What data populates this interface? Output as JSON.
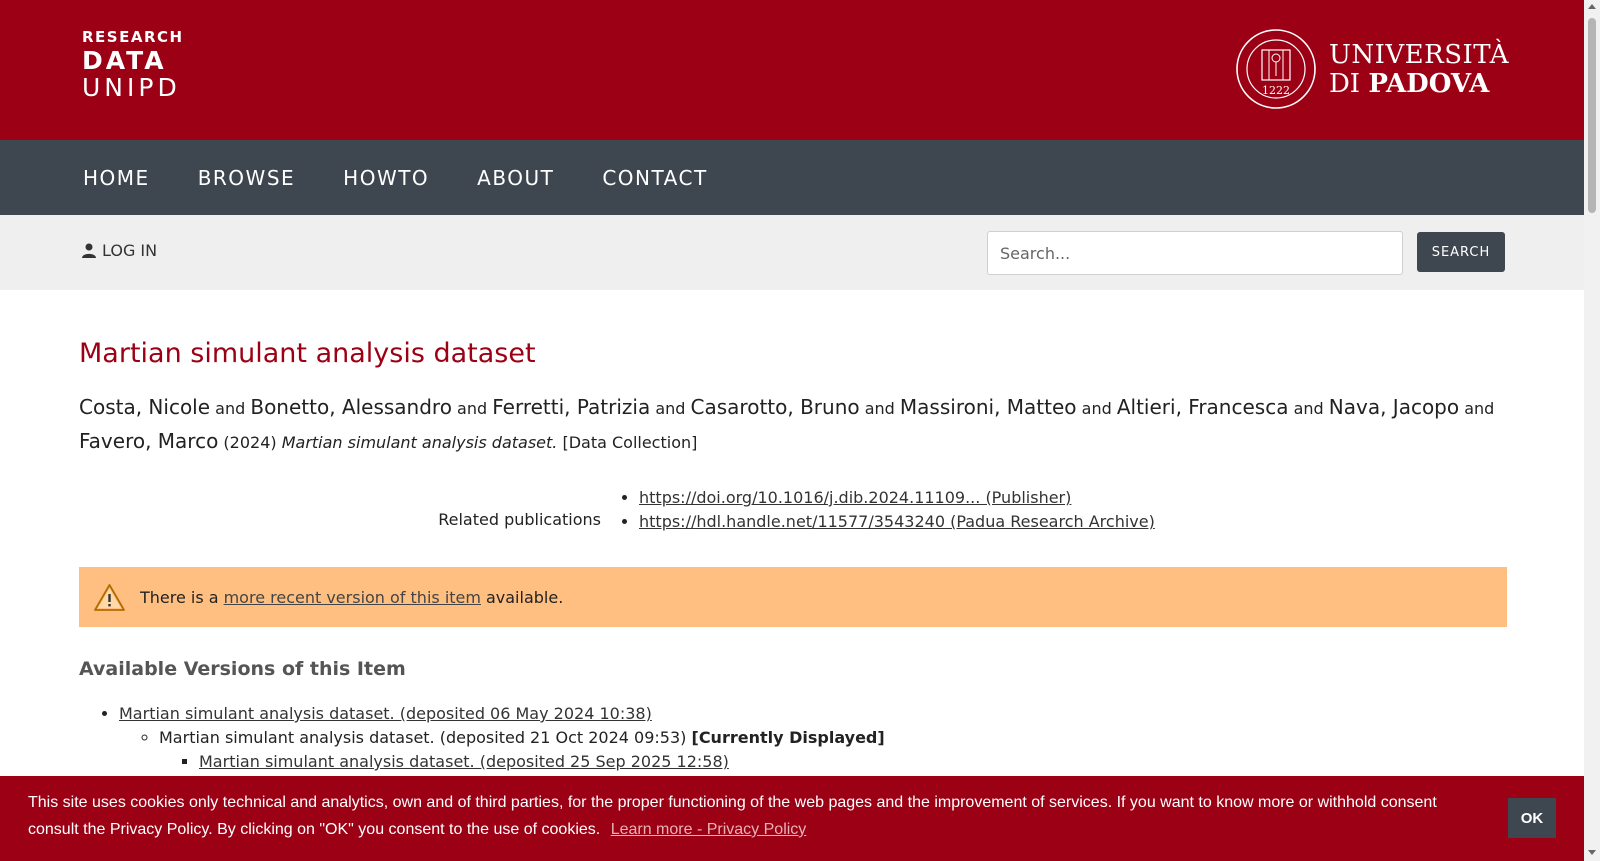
{
  "header": {
    "logo_line1": "RESEARCH",
    "logo_line2": "DATA",
    "logo_line3": "UNIPD",
    "university_line1": "UNIVERSITÀ",
    "university_di": "DI",
    "university_padova": "PADOVA",
    "seal_year": "1222",
    "seal_icon": "university-seal-icon"
  },
  "nav": {
    "items": [
      "HOME",
      "BROWSE",
      "HOWTO",
      "ABOUT",
      "CONTACT"
    ]
  },
  "subbar": {
    "login_label": "LOG IN",
    "login_icon": "user-icon",
    "search_placeholder": "Search...",
    "search_button": "SEARCH"
  },
  "record": {
    "title": "Martian simulant analysis dataset",
    "authors": [
      "Costa, Nicole",
      "Bonetto, Alessandro",
      "Ferretti, Patrizia",
      "Casarotto, Bruno",
      "Massironi, Matteo",
      "Altieri, Francesca",
      "Nava, Jacopo",
      "Favero, Marco"
    ],
    "conjunction": "and",
    "year": "(2024)",
    "citation_title": "Martian simulant analysis dataset.",
    "type": "[Data Collection]",
    "related_label": "Related publications",
    "related": [
      "https://doi.org/10.1016/j.dib.2024.11109... (Publisher)",
      "https://hdl.handle.net/11577/3543240 (Padua Research Archive)"
    ]
  },
  "alert": {
    "icon": "warning-icon",
    "prefix": "There is a",
    "link": "more recent version of this item",
    "suffix": "available."
  },
  "versions": {
    "heading": "Available Versions of this Item",
    "v1": "Martian simulant analysis dataset. (deposited 06 May 2024 10:38)",
    "v2": "Martian simulant analysis dataset. (deposited 21 Oct 2024 09:53)",
    "v2_tag": "[Currently Displayed]",
    "v3": "Martian simulant analysis dataset. (deposited 25 Sep 2025 12:58)"
  },
  "cookie": {
    "text": "This site uses cookies only technical and analytics, own and of third parties, for the proper functioning of the web pages and the improvement of services. If you want to know more or withhold consent consult the Privacy Policy. By clicking on \"OK\" you consent to the use of cookies.",
    "link": "Learn more - Privacy Policy",
    "ok": "OK"
  },
  "colors": {
    "brand_red": "#9b0014",
    "nav_slate": "#3e4650",
    "alert_orange": "#ffbf80"
  }
}
